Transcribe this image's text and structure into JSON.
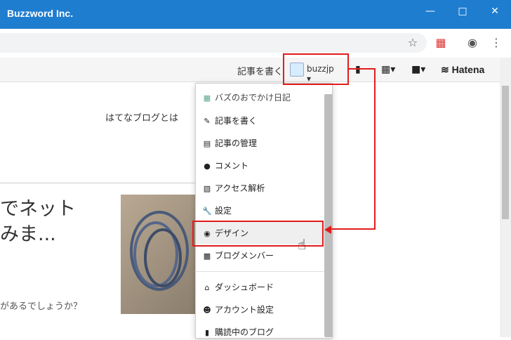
{
  "window": {
    "title": "Buzzword Inc."
  },
  "toolbar": {
    "star_icon": "star-icon",
    "account_icon": "account-icon",
    "menu_icon": "more-icon"
  },
  "hatena_bar": {
    "write_label": "記事を書く",
    "username": "buzzjp",
    "logo": "Hatena"
  },
  "page": {
    "about_link": "はてなブログとは",
    "article_title": "でネット\nみま...",
    "article_excerpt": "があるでしょうか？"
  },
  "dropdown": {
    "items": [
      {
        "label": "バズのおでかけ日記",
        "icon": "blog-icon"
      },
      {
        "label": "記事を書く",
        "icon": "edit-icon"
      },
      {
        "label": "記事の管理",
        "icon": "document-icon"
      },
      {
        "label": "コメント",
        "icon": "comment-icon"
      },
      {
        "label": "アクセス解析",
        "icon": "signal-icon"
      },
      {
        "label": "設定",
        "icon": "wrench-icon"
      },
      {
        "label": "デザイン",
        "icon": "palette-icon"
      },
      {
        "label": "ブログメンバー",
        "icon": "members-icon"
      },
      {
        "label": "ダッシュボード",
        "icon": "home-icon"
      },
      {
        "label": "アカウント設定",
        "icon": "user-icon"
      },
      {
        "label": "購読中のブログ",
        "icon": "bookmark-icon"
      }
    ]
  },
  "colors": {
    "titlebar": "#1f7dd0",
    "annotation": "#e21c1c"
  }
}
